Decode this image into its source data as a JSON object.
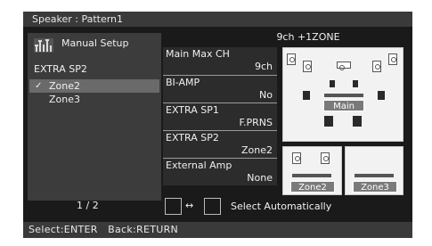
{
  "title": "Speaker : Pattern1",
  "left_panel": {
    "heading": "Manual Setup",
    "subheading": "EXTRA SP2",
    "options": [
      {
        "label": "Zone2",
        "selected": true
      },
      {
        "label": "Zone3",
        "selected": false
      }
    ],
    "check_mark": "✓",
    "page": "1 / 2"
  },
  "config_header": "9ch +1ZONE",
  "settings": [
    {
      "label": "Main Max CH",
      "value": "9ch"
    },
    {
      "label": "BI-AMP",
      "value": "No"
    },
    {
      "label": "EXTRA SP1",
      "value": "F.PRNS"
    },
    {
      "label": "EXTRA SP2",
      "value": "Zone2"
    },
    {
      "label": "External Amp",
      "value": "None"
    }
  ],
  "diagram": {
    "main_label": "Main",
    "zone2_label": "Zone2",
    "zone3_label": "Zone3"
  },
  "select_auto": {
    "arrow": "↔",
    "text": "Select Automatically"
  },
  "status_bar": "Select:ENTER   Back:RETURN",
  "colors": {
    "screen_bg": "#1a1a1a",
    "bar_bg": "#3a3a3a",
    "panel_bg": "#3c3c3c",
    "highlight": "#6a6a6a",
    "zone_tag": "#7a7a7a"
  }
}
